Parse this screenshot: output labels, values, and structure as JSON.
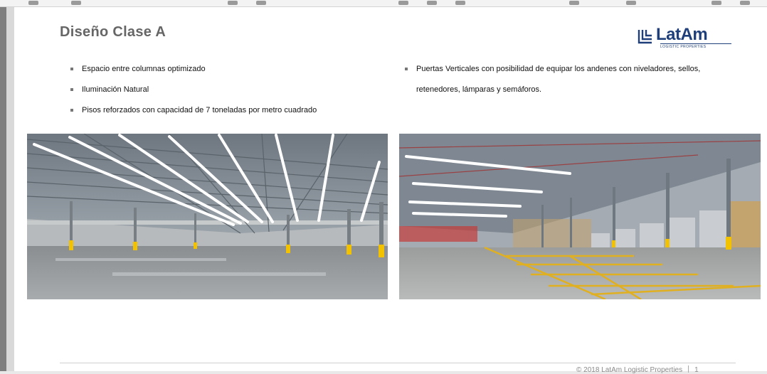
{
  "slide": {
    "title": "Diseño Clase A",
    "logo_text": "LatAm",
    "logo_subtext": "LOGISTIC PROPERTIES",
    "bullets_left": [
      "Espacio entre columnas optimizado",
      "Iluminación Natural",
      "Pisos reforzados con capacidad de 7 toneladas por metro cuadrado"
    ],
    "bullets_right": [
      "Puertas Verticales con posibilidad de equipar los andenes con niveladores, sellos, retenedores, lámparas y semáforos."
    ],
    "footer": {
      "copyright": "© 2018 LatAm Logistic Properties",
      "page_number": "1"
    }
  },
  "colors": {
    "title": "#666666",
    "logo_blue": "#1f3f7a",
    "column_yellow": "#f2c200",
    "floor_line_yellow": "#e0b020"
  },
  "icons": {
    "logo_mark": "latam-logo-mark-icon"
  }
}
